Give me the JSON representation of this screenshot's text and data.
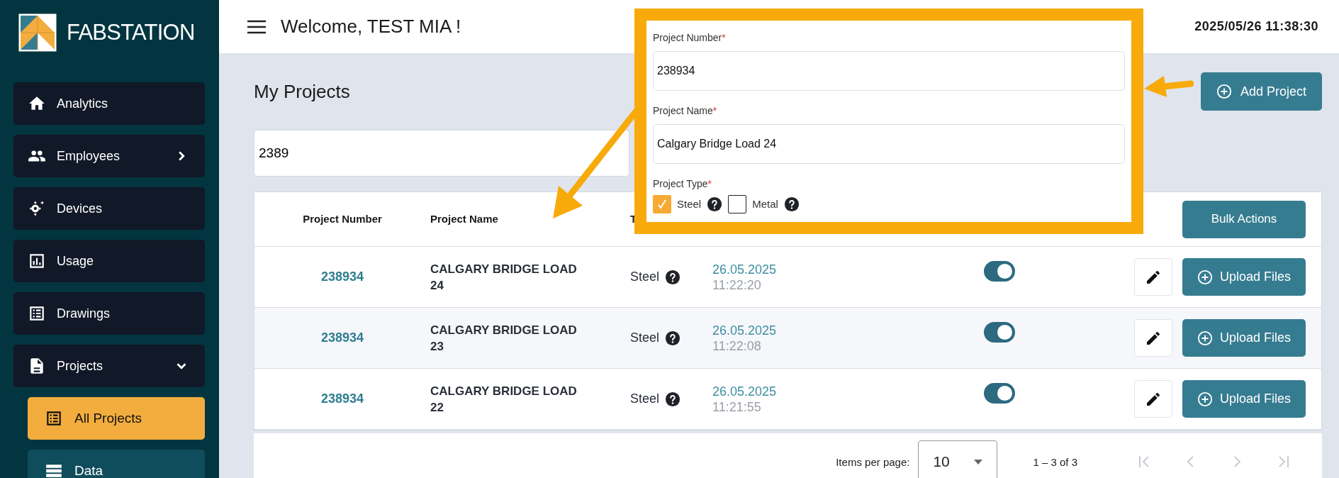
{
  "brand": {
    "name": "FABSTATION"
  },
  "sidebar": {
    "items": [
      {
        "label": "Analytics",
        "kind": "link",
        "selected": false
      },
      {
        "label": "Employees",
        "kind": "group",
        "expanded": false,
        "selected": false
      },
      {
        "label": "Devices",
        "kind": "link",
        "selected": false
      },
      {
        "label": "Usage",
        "kind": "link",
        "selected": false
      },
      {
        "label": "Drawings",
        "kind": "link",
        "selected": false
      },
      {
        "label": "Projects",
        "kind": "group",
        "expanded": true,
        "selected": false,
        "children": [
          {
            "label": "All Projects",
            "selected": true
          },
          {
            "label": "Data",
            "selected": false
          }
        ]
      }
    ]
  },
  "header": {
    "title": "Welcome, TEST MIA !",
    "datetime": "2025/05/26 11:38:30"
  },
  "page": {
    "title": "My Projects",
    "add_button": "Add Project",
    "search": {
      "value": "2389"
    }
  },
  "table": {
    "columns": [
      "Project Number",
      "Project Name",
      "T"
    ],
    "bulk_button": "Bulk Actions",
    "rows": [
      {
        "number": "238934",
        "name": "CALGARY BRIDGE LOAD 24",
        "type": "Steel",
        "date": "26.05.2025",
        "time": "11:22:20",
        "active": true,
        "upload": "Upload Files"
      },
      {
        "number": "238934",
        "name": "CALGARY BRIDGE LOAD 23",
        "type": "Steel",
        "date": "26.05.2025",
        "time": "11:22:08",
        "active": true,
        "upload": "Upload Files"
      },
      {
        "number": "238934",
        "name": "CALGARY BRIDGE LOAD 22",
        "type": "Steel",
        "date": "26.05.2025",
        "time": "11:21:55",
        "active": true,
        "upload": "Upload Files"
      }
    ]
  },
  "pagination": {
    "label": "Items per page:",
    "page_size": "10",
    "range": "1 – 3 of 3",
    "buttons": [
      {
        "kind": "first",
        "disabled": true
      },
      {
        "kind": "prev",
        "disabled": true
      },
      {
        "kind": "next",
        "disabled": true
      },
      {
        "kind": "last",
        "disabled": true
      }
    ]
  },
  "callout": {
    "fields": [
      {
        "label": "Project Number",
        "required_mark": "*",
        "value": "238934"
      },
      {
        "label": "Project Name",
        "required_mark": "*",
        "value": "Calgary Bridge Load 24"
      }
    ],
    "type_field": {
      "label": "Project Type",
      "required_mark": "*",
      "options": [
        {
          "label": "Steel",
          "checked": true
        },
        {
          "label": "Metal",
          "checked": false
        }
      ]
    }
  }
}
